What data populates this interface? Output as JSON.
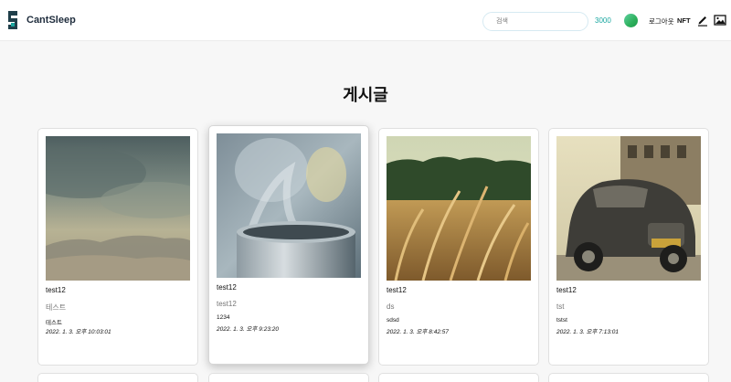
{
  "header": {
    "brand": "CantSleep",
    "search_placeholder": "검색",
    "credits": "3000",
    "logout_label": "로그아웃",
    "nft_label": "NFT"
  },
  "main": {
    "title": "게시글"
  },
  "posts": [
    {
      "author": "test12",
      "title": "테스트",
      "body": "테스트",
      "date": "2022. 1. 3. 오후 10:03:01",
      "image": "stormy-sky-landscape"
    },
    {
      "author": "test12",
      "title": "test12",
      "body": "1234",
      "date": "2022. 1. 3. 오후 9:23:20",
      "image": "steaming-pot"
    },
    {
      "author": "test12",
      "title": "ds",
      "body": "sdsd",
      "date": "2022. 1. 3. 오후 8:42:57",
      "image": "wheat-field"
    },
    {
      "author": "test12",
      "title": "tst",
      "body": "tstst",
      "date": "2022. 1. 3. 오후 7:13:01",
      "image": "vintage-car"
    }
  ],
  "colors": {
    "accent": "#1aa7a0",
    "brand": "#1f2d3d"
  }
}
